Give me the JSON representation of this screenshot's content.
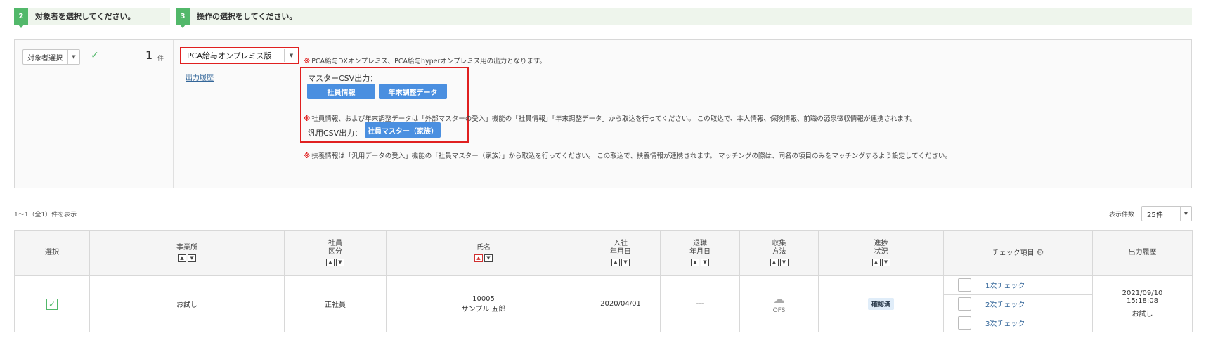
{
  "steps": {
    "step2": {
      "num": "2",
      "text": "対象者を選択してください。"
    },
    "step3": {
      "num": "3",
      "text": "操作の選択をしてください。"
    }
  },
  "target": {
    "select_label": "対象者選択",
    "count": "1",
    "count_unit": "件"
  },
  "operation": {
    "version_select": "PCA給与オンプレミス版",
    "history_link": "出力履歴",
    "note1_mark": "※",
    "note1": "PCA給与DXオンプレミス、PCA給与hyperオンプレミス用の出力となります。",
    "master_csv_title": "マスターCSV出力：",
    "btn_shain": "社員情報",
    "btn_nenmatsu": "年末調整データ",
    "note2_mark": "※",
    "note2": "社員情報、および年末調整データは「外部マスターの受入」機能の「社員情報」「年末調整データ」から取込を行ってください。 この取込で、本人情報、保険情報、前職の源泉徴収情報が連携されます。",
    "general_csv_title": "汎用CSV出力：",
    "btn_family": "社員マスター（家族）",
    "note3_mark": "※",
    "note3": "扶養情報は「汎用データの受入」機能の「社員マスター（家族）」から取込を行ってください。 この取込で、扶養情報が連携されます。 マッチングの際は、同名の項目のみをマッチングするよう設定してください。"
  },
  "list": {
    "count_text": "1～1（全1）件を表示",
    "per_page_label": "表示件数",
    "per_page_value": "25件"
  },
  "table": {
    "headers": {
      "select": "選択",
      "office": "事業所",
      "emp_type_1": "社員",
      "emp_type_2": "区分",
      "name": "氏名",
      "join_1": "入社",
      "join_2": "年月日",
      "leave_1": "退職",
      "leave_2": "年月日",
      "collect_1": "収集",
      "collect_2": "方法",
      "progress_1": "進捗",
      "progress_2": "状況",
      "check_items": "チェック項目",
      "output_history": "出力履歴"
    },
    "row": {
      "office": "お試し",
      "emp_type": "正社員",
      "emp_no": "10005",
      "name": "サンプル 五郎",
      "join_date": "2020/04/01",
      "leave_date": "---",
      "collect": "OFS",
      "progress": "確認済",
      "check1": "1次チェック",
      "check2": "2次チェック",
      "check3": "3次チェック",
      "hist_date": "2021/09/10",
      "hist_time": "15:18:08",
      "hist_user": "お試し"
    }
  },
  "colors": {
    "accent_green": "#52b86a",
    "highlight_red": "#e02020",
    "button_blue": "#4a8fe0",
    "link_blue": "#336699"
  }
}
